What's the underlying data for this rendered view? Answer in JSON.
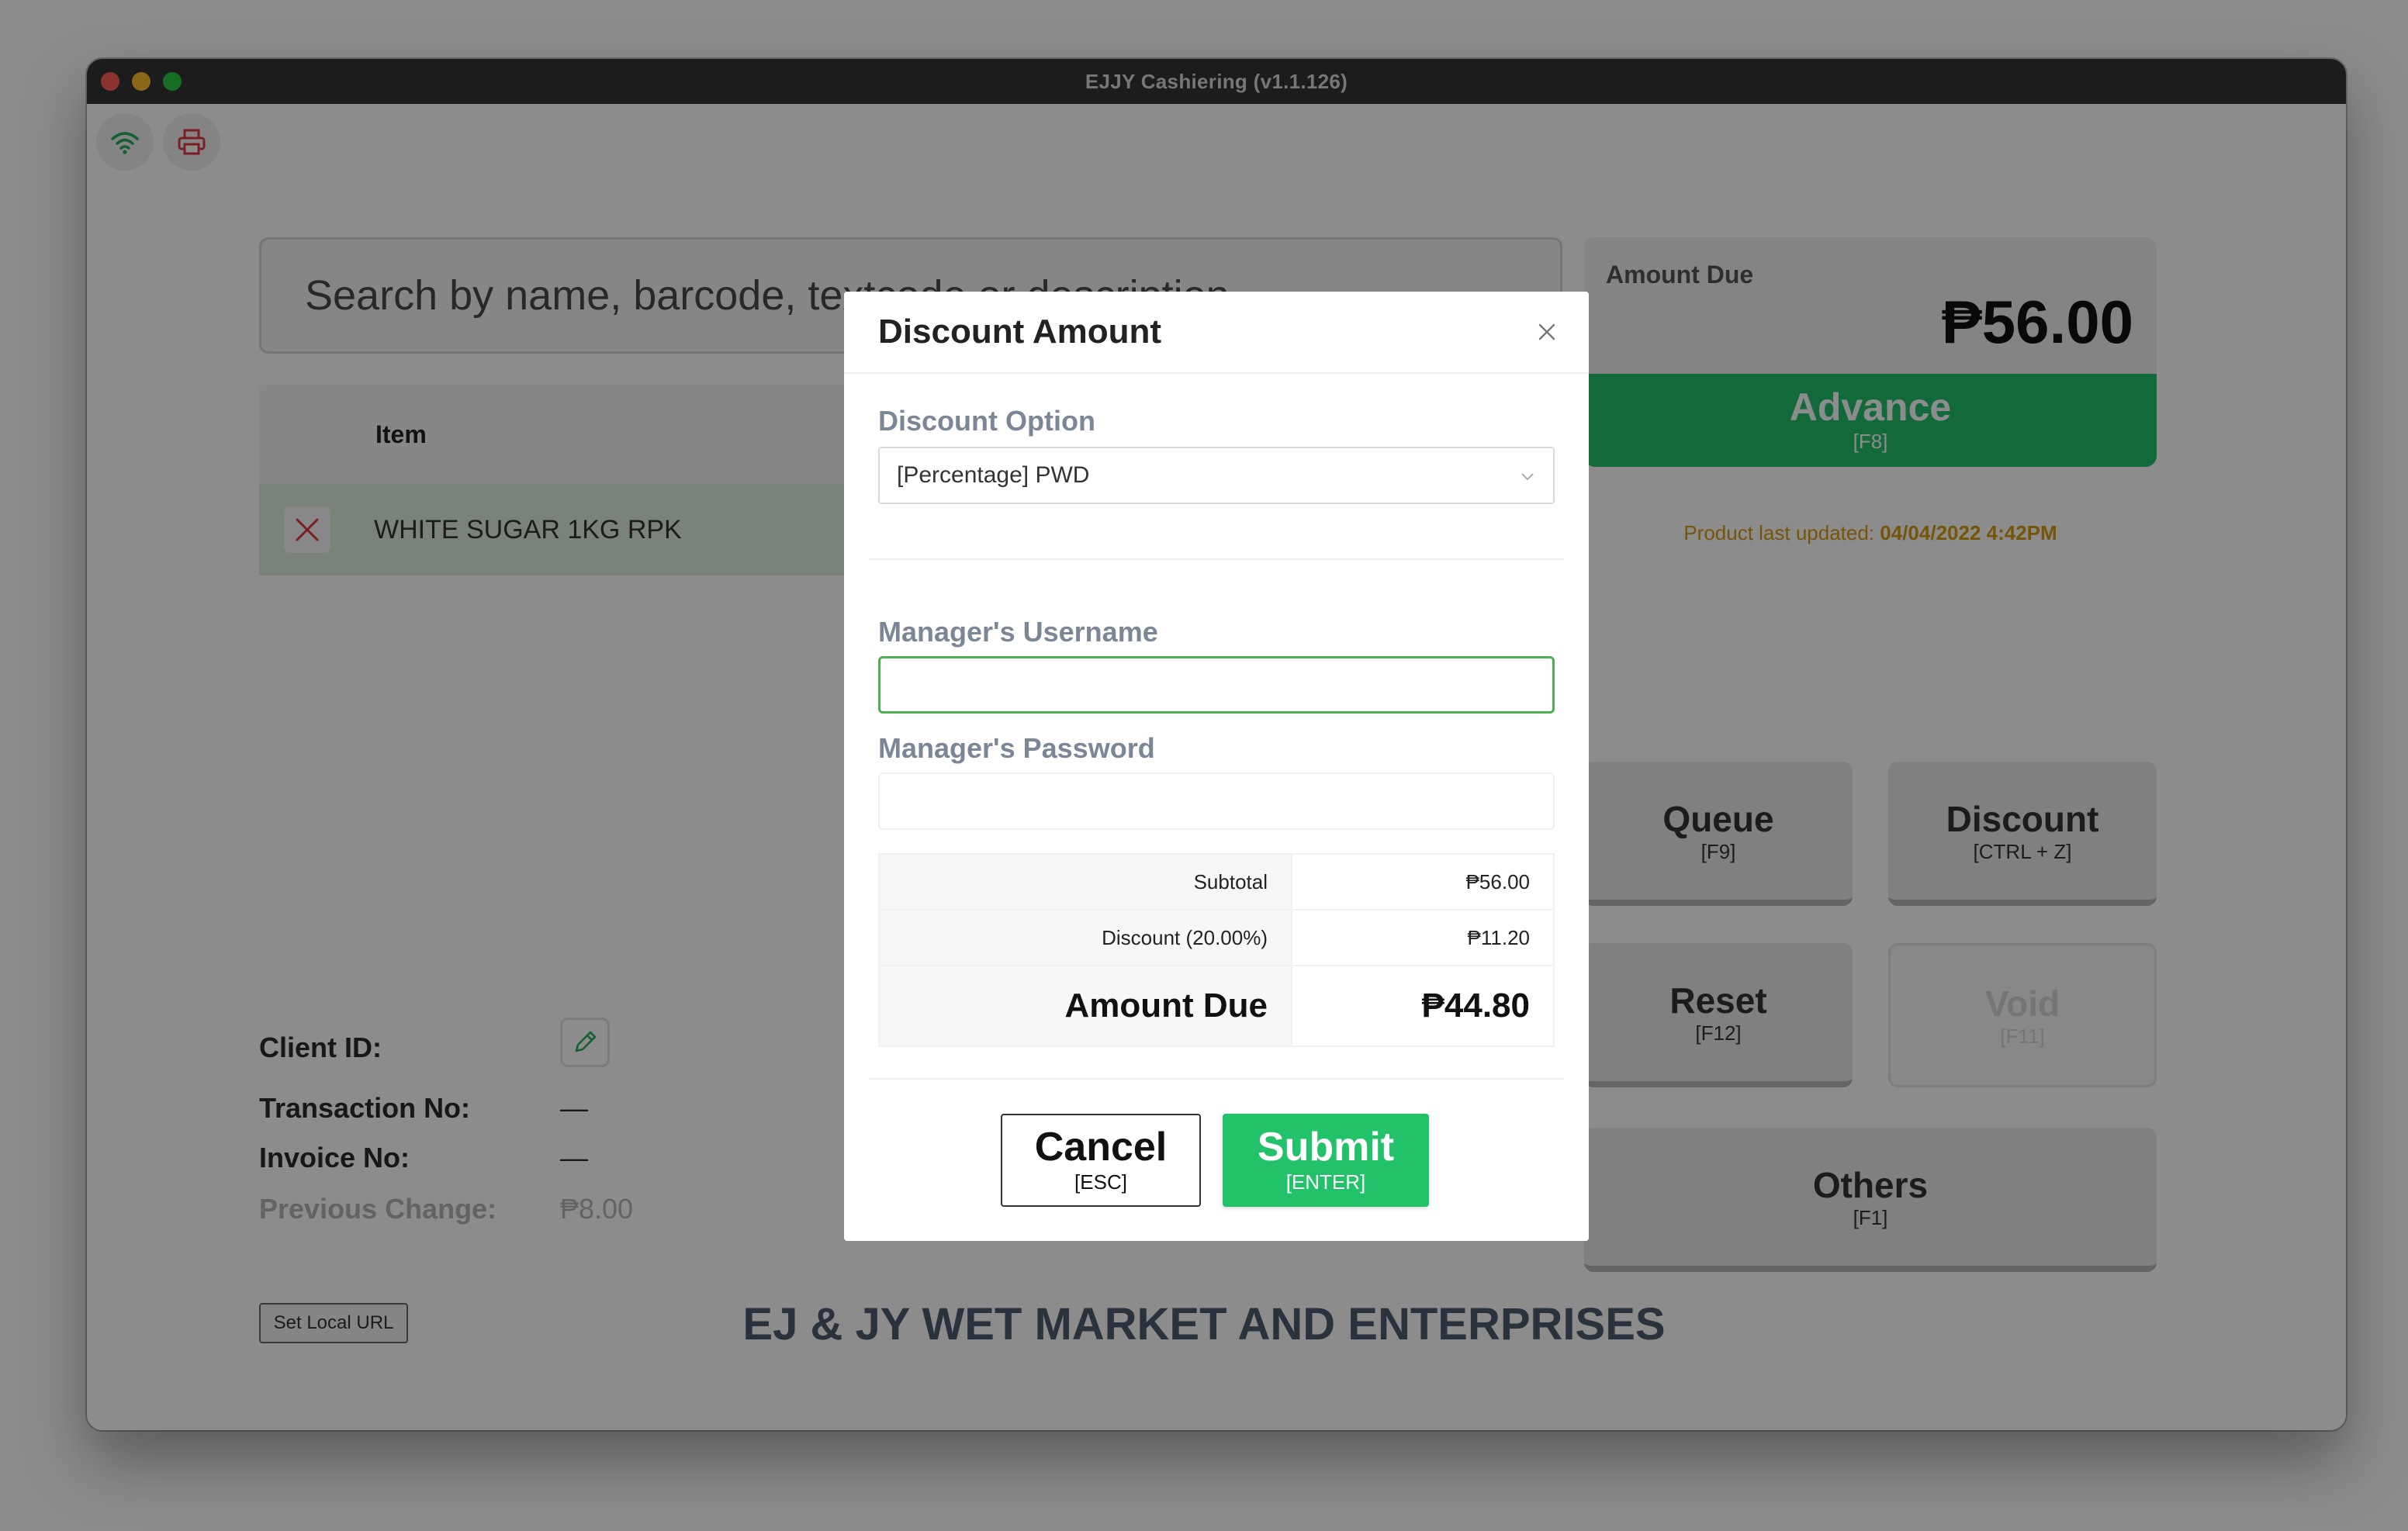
{
  "window": {
    "title": "EJJY Cashiering (v1.1.126)"
  },
  "toolbar": {
    "wifi_icon": "wifi-icon",
    "printer_icon": "printer-icon"
  },
  "search": {
    "placeholder": "Search by name, barcode, textcode or description"
  },
  "table": {
    "header_item": "Item",
    "rows": [
      {
        "name": "WHITE SUGAR 1KG RPK"
      }
    ]
  },
  "transaction": {
    "client_id_label": "Client ID:",
    "transaction_no_label": "Transaction No:",
    "transaction_no_value": "—",
    "invoice_no_label": "Invoice No:",
    "invoice_no_value": "—",
    "previous_change_label": "Previous Change:",
    "previous_change_value": "₱8.00"
  },
  "set_local_url_label": "Set Local URL",
  "company_name": "EJ & JY WET MARKET AND ENTERPRISES",
  "amount_due": {
    "label": "Amount Due",
    "value": "₱56.00"
  },
  "advance": {
    "label": "Advance",
    "key": "[F8]"
  },
  "product_updated": {
    "prefix": "Product last updated: ",
    "date": "04/04/2022 4:42PM"
  },
  "actions": {
    "queue": {
      "label": "Queue",
      "key": "[F9]"
    },
    "discount": {
      "label": "Discount",
      "key": "[CTRL + Z]"
    },
    "reset": {
      "label": "Reset",
      "key": "[F12]"
    },
    "void": {
      "label": "Void",
      "key": "[F11]"
    },
    "others": {
      "label": "Others",
      "key": "[F1]"
    }
  },
  "modal": {
    "title": "Discount Amount",
    "discount_option_label": "Discount Option",
    "discount_option_value": "[Percentage] PWD",
    "manager_username_label": "Manager's Username",
    "manager_username_value": "",
    "manager_password_label": "Manager's Password",
    "manager_password_value": "",
    "subtotal_label": "Subtotal",
    "subtotal_value": "₱56.00",
    "discount_label": "Discount (20.00%)",
    "discount_value": "₱11.20",
    "amount_due_label": "Amount Due",
    "amount_due_value": "₱44.80",
    "cancel": {
      "label": "Cancel",
      "key": "[ESC]"
    },
    "submit": {
      "label": "Submit",
      "key": "[ENTER]"
    }
  },
  "colors": {
    "accent_green": "#21c26a",
    "focus_green": "#4caf50",
    "warning_orange": "#d89b12",
    "remove_red": "#e0393e"
  }
}
